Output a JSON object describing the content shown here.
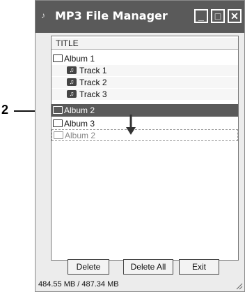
{
  "window": {
    "title": "MP3 File Manager",
    "app_icon": "speaker-icon",
    "controls": {
      "minimize": "_",
      "maximize": "□",
      "close": "✕"
    }
  },
  "list": {
    "column_header": "TITLE",
    "rows": [
      {
        "label": "Album 1",
        "type": "album"
      },
      {
        "label": "Track 1",
        "type": "track"
      },
      {
        "label": "Track 2",
        "type": "track"
      },
      {
        "label": "Track 3",
        "type": "track"
      },
      {
        "label": "Album 2",
        "type": "album",
        "state": "selected"
      },
      {
        "label": "Album 3",
        "type": "album"
      },
      {
        "label": "Album 2",
        "type": "album",
        "state": "drag-ghost"
      }
    ]
  },
  "buttons": {
    "delete": "Delete",
    "delete_all": "Delete All",
    "exit": "Exit"
  },
  "status": {
    "capacity": "484.55 MB / 487.34 MB"
  },
  "callout": {
    "number": "2"
  },
  "colors": {
    "titlebar": "#5a5a5a",
    "selected_row": "#5a5a5a",
    "window_bg": "#ececec"
  }
}
